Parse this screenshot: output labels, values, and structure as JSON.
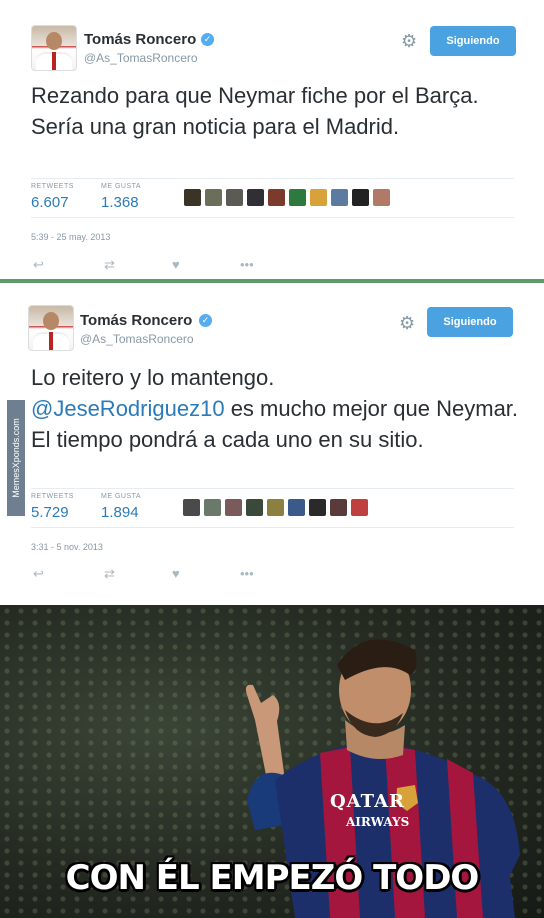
{
  "tweets": [
    {
      "author": "Tomás Roncero",
      "handle": "@As_TomasRoncero",
      "follow_label": "Siguiendo",
      "text": "Rezando para que Neymar fiche por el Barça. Sería una gran noticia para el Madrid.",
      "retweets_label": "RETWEETS",
      "retweets": "6.607",
      "likes_label": "ME GUSTA",
      "likes": "1.368",
      "timestamp": "5:39 - 25 may. 2013",
      "liker_colors": [
        "#3a3326",
        "#6b6f5a",
        "#5c5a55",
        "#2f2f35",
        "#7b3a2a",
        "#2e7a3d",
        "#d8a23a",
        "#5d7aa0",
        "#222",
        "#b07a66"
      ]
    },
    {
      "author": "Tomás Roncero",
      "handle": "@As_TomasRoncero",
      "follow_label": "Siguiendo",
      "text_before": "Lo reitero y lo mantengo.",
      "mention": "@JeseRodriguez10",
      "text_after": "es mucho mejor que Neymar. El tiempo pondrá a cada uno en su sitio.",
      "retweets_label": "RETWEETS",
      "retweets": "5.729",
      "likes_label": "ME GUSTA",
      "likes": "1.894",
      "timestamp": "3:31 - 5 nov. 2013",
      "liker_colors": [
        "#4a4a4a",
        "#6a7a6a",
        "#7a5a5a",
        "#3a4a3a",
        "#8a8040",
        "#3a5a8a",
        "#2a2a2a",
        "#5a3a3a",
        "#c04040"
      ]
    }
  ],
  "watermark": "MemesXponds.com",
  "caption": "CON ÉL EMPEZÓ TODO",
  "jersey_text_1": "QATAR",
  "jersey_text_2": "AIRWAYS"
}
